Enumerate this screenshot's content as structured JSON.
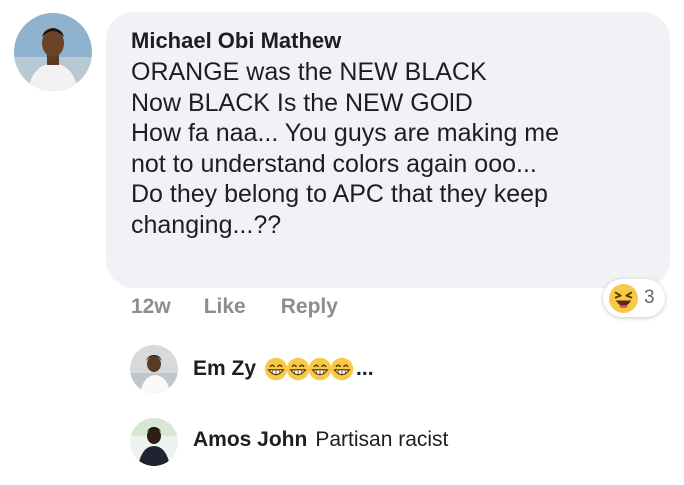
{
  "comment": {
    "author": "Michael Obi Mathew",
    "lines": [
      "ORANGE was the NEW BLACK",
      "Now BLACK Is the NEW GOlD",
      "How fa naa... You guys are making me",
      "not to understand colors again ooo...",
      "Do they belong to APC that they keep",
      "changing...??"
    ],
    "timestamp": "12w",
    "like_label": "Like",
    "reply_label": "Reply",
    "reaction": {
      "icon": "laughing-emoji-icon",
      "count": "3"
    }
  },
  "replies": [
    {
      "author": "Em Zy",
      "emoji_icon": "grinning-emoji-icon",
      "emoji_repeat": 4,
      "ellipsis": "..."
    },
    {
      "author": "Amos John",
      "text": "Partisan racist"
    }
  ],
  "colors": {
    "bubble_bg": "#f0f2f5",
    "text": "#1c1e21",
    "meta": "#8a8d91",
    "emoji_yellow": "#f7c948"
  }
}
